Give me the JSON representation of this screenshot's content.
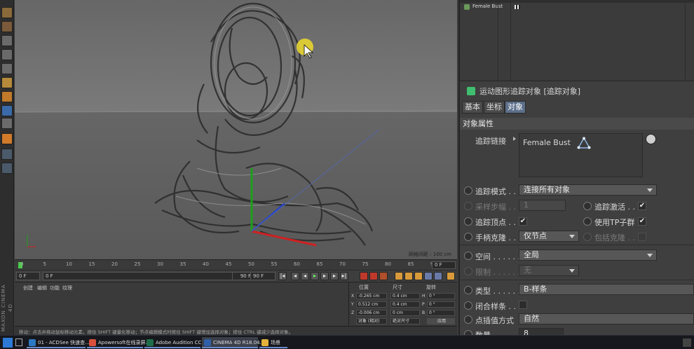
{
  "timeline": {
    "ticks": [
      "0",
      "5",
      "10",
      "15",
      "20",
      "25",
      "30",
      "35",
      "40",
      "45",
      "50",
      "55",
      "60",
      "65",
      "70",
      "75",
      "80",
      "85",
      "90"
    ],
    "current_frame": "0 F"
  },
  "transport": {
    "start_field": "0 F",
    "cur_field": "0 F",
    "end_field": "90 F",
    "end_field2": "90 F"
  },
  "viewport": {
    "info": "网格间距 : 100 cm"
  },
  "material_panel": {
    "menu": [
      "创建",
      "编辑",
      "功能",
      "纹理"
    ]
  },
  "coords": {
    "headers": [
      "位置",
      "尺寸",
      "旋转"
    ],
    "rows": [
      {
        "axis": "X",
        "pos": "-0.265 cm",
        "size": "0.4 cm",
        "rot_axis": "H",
        "rot": "0 °"
      },
      {
        "axis": "Y",
        "pos": "0.512 cm",
        "size": "0.4 cm",
        "rot_axis": "P",
        "rot": "0 °"
      },
      {
        "axis": "Z",
        "pos": "-0.006 cm",
        "size": "0 cm",
        "rot_axis": "B",
        "rot": "0 °"
      }
    ],
    "mode_left": "对象 (相对)",
    "mode_mid": "绝对尺寸",
    "apply": "应用"
  },
  "status": "移动：点击并拖动鼠标移动元素。按住 SHIFT 键量化移动；节点编辑模式时按住 SHIFT 键增加选择对象；按住 CTRL 键减少选择对象。",
  "object_manager": {
    "items": [
      "Female Bust"
    ]
  },
  "attributes": {
    "title": "运动图形追踪对象 [追踪对象]",
    "tabs": [
      "基本",
      "坐标",
      "对象"
    ],
    "section": "对象属性",
    "trace_link_label": "追踪链接",
    "trace_link_value": "Female Bust",
    "trace_mode_label": "追踪模式 . .",
    "trace_mode_value": "连接所有对象",
    "sample_step_label": "采样步幅 . .",
    "sample_step_value": "1",
    "trace_active_label": "追踪激活 . .",
    "trace_vertices_label": "追踪顶点 . .",
    "use_tp_label": "使用TP子群",
    "handle_clone_label": "手柄克隆 . .",
    "handle_clone_value": "仅节点",
    "include_clone_label": "包括克隆 . .",
    "space_label": "空间  . . . . . .",
    "space_value": "全局",
    "limit_label": "限制  . . . . . .",
    "limit_value": "无",
    "type_label": "类型  . . . . . .",
    "type_value": "B-样条",
    "closed_spline_label": "闭合样条 . .",
    "interp_label": "点插值方式",
    "interp_value": "自然",
    "count_label": "数量 . . . . . .",
    "count_value": "8"
  },
  "taskbar": [
    {
      "label": "01 - ACDSee 快速查...",
      "color": "#2b79c2"
    },
    {
      "label": "Apowersoft在线录屏...",
      "color": "#d9503c"
    },
    {
      "label": "Adobe Audition CC ...",
      "color": "#1e6e4a"
    },
    {
      "label": "CINEMA 4D R18.04...",
      "color": "#2e5fa8"
    },
    {
      "label": "场景",
      "color": "#e2b23a"
    }
  ]
}
